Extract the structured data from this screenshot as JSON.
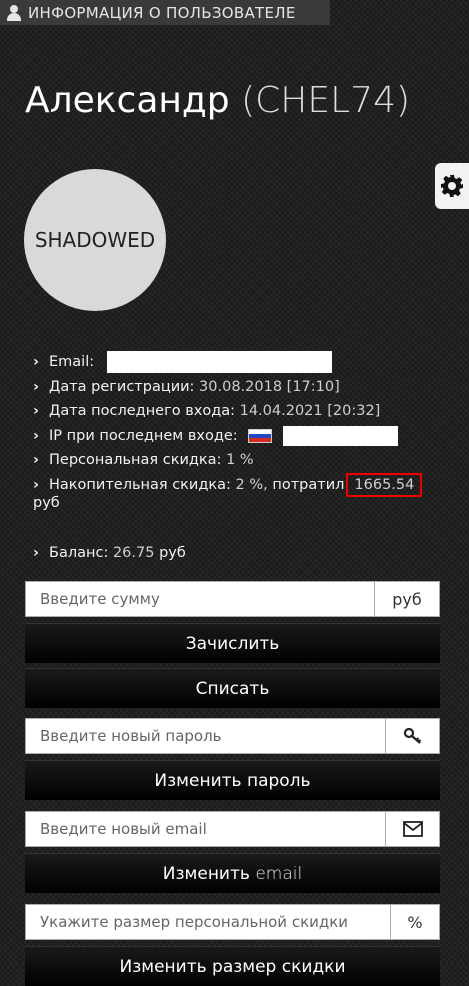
{
  "header": {
    "title": "ИНФОРМАЦИЯ О ПОЛЬЗОВАТЕЛЕ",
    "icon": "user-icon"
  },
  "profile": {
    "name": "Александр",
    "nick": "(CHEL74)",
    "avatar_text": "SHADOWED"
  },
  "settings": {
    "icon": "gear-icon"
  },
  "info": {
    "email_label": "Email:",
    "reg_label": "Дата регистрации:",
    "reg_value": "30.08.2018 [17:10]",
    "last_login_label": "Дата последнего входа:",
    "last_login_value": "14.04.2021 [20:32]",
    "ip_label": "IP при последнем входе:",
    "personal_discount_label": "Персональная скидка:",
    "personal_discount_value": "1 %",
    "accum_label": "Накопительная скидка:",
    "accum_value": "2 %,",
    "spent_label": "потратил",
    "spent_value": "1665.54",
    "spent_unit": "руб"
  },
  "balance": {
    "label": "Баланс:",
    "value": "26.75",
    "unit": "руб"
  },
  "amount_form": {
    "placeholder": "Введите сумму",
    "addon": "руб",
    "credit_button": "Зачислить",
    "debit_button": "Списать"
  },
  "password_form": {
    "placeholder": "Введите новый пароль",
    "icon": "key-icon",
    "button": "Изменить пароль"
  },
  "email_form": {
    "placeholder": "Введите новый email",
    "icon": "envelope-icon",
    "button_bold": "Изменить",
    "button_light": "email"
  },
  "discount_form": {
    "placeholder": "Укажите размер персональной скидки",
    "addon": "%",
    "button": "Изменить размер скидки"
  },
  "colors": {
    "highlight": "#e00000",
    "button_bg": "#000000"
  }
}
